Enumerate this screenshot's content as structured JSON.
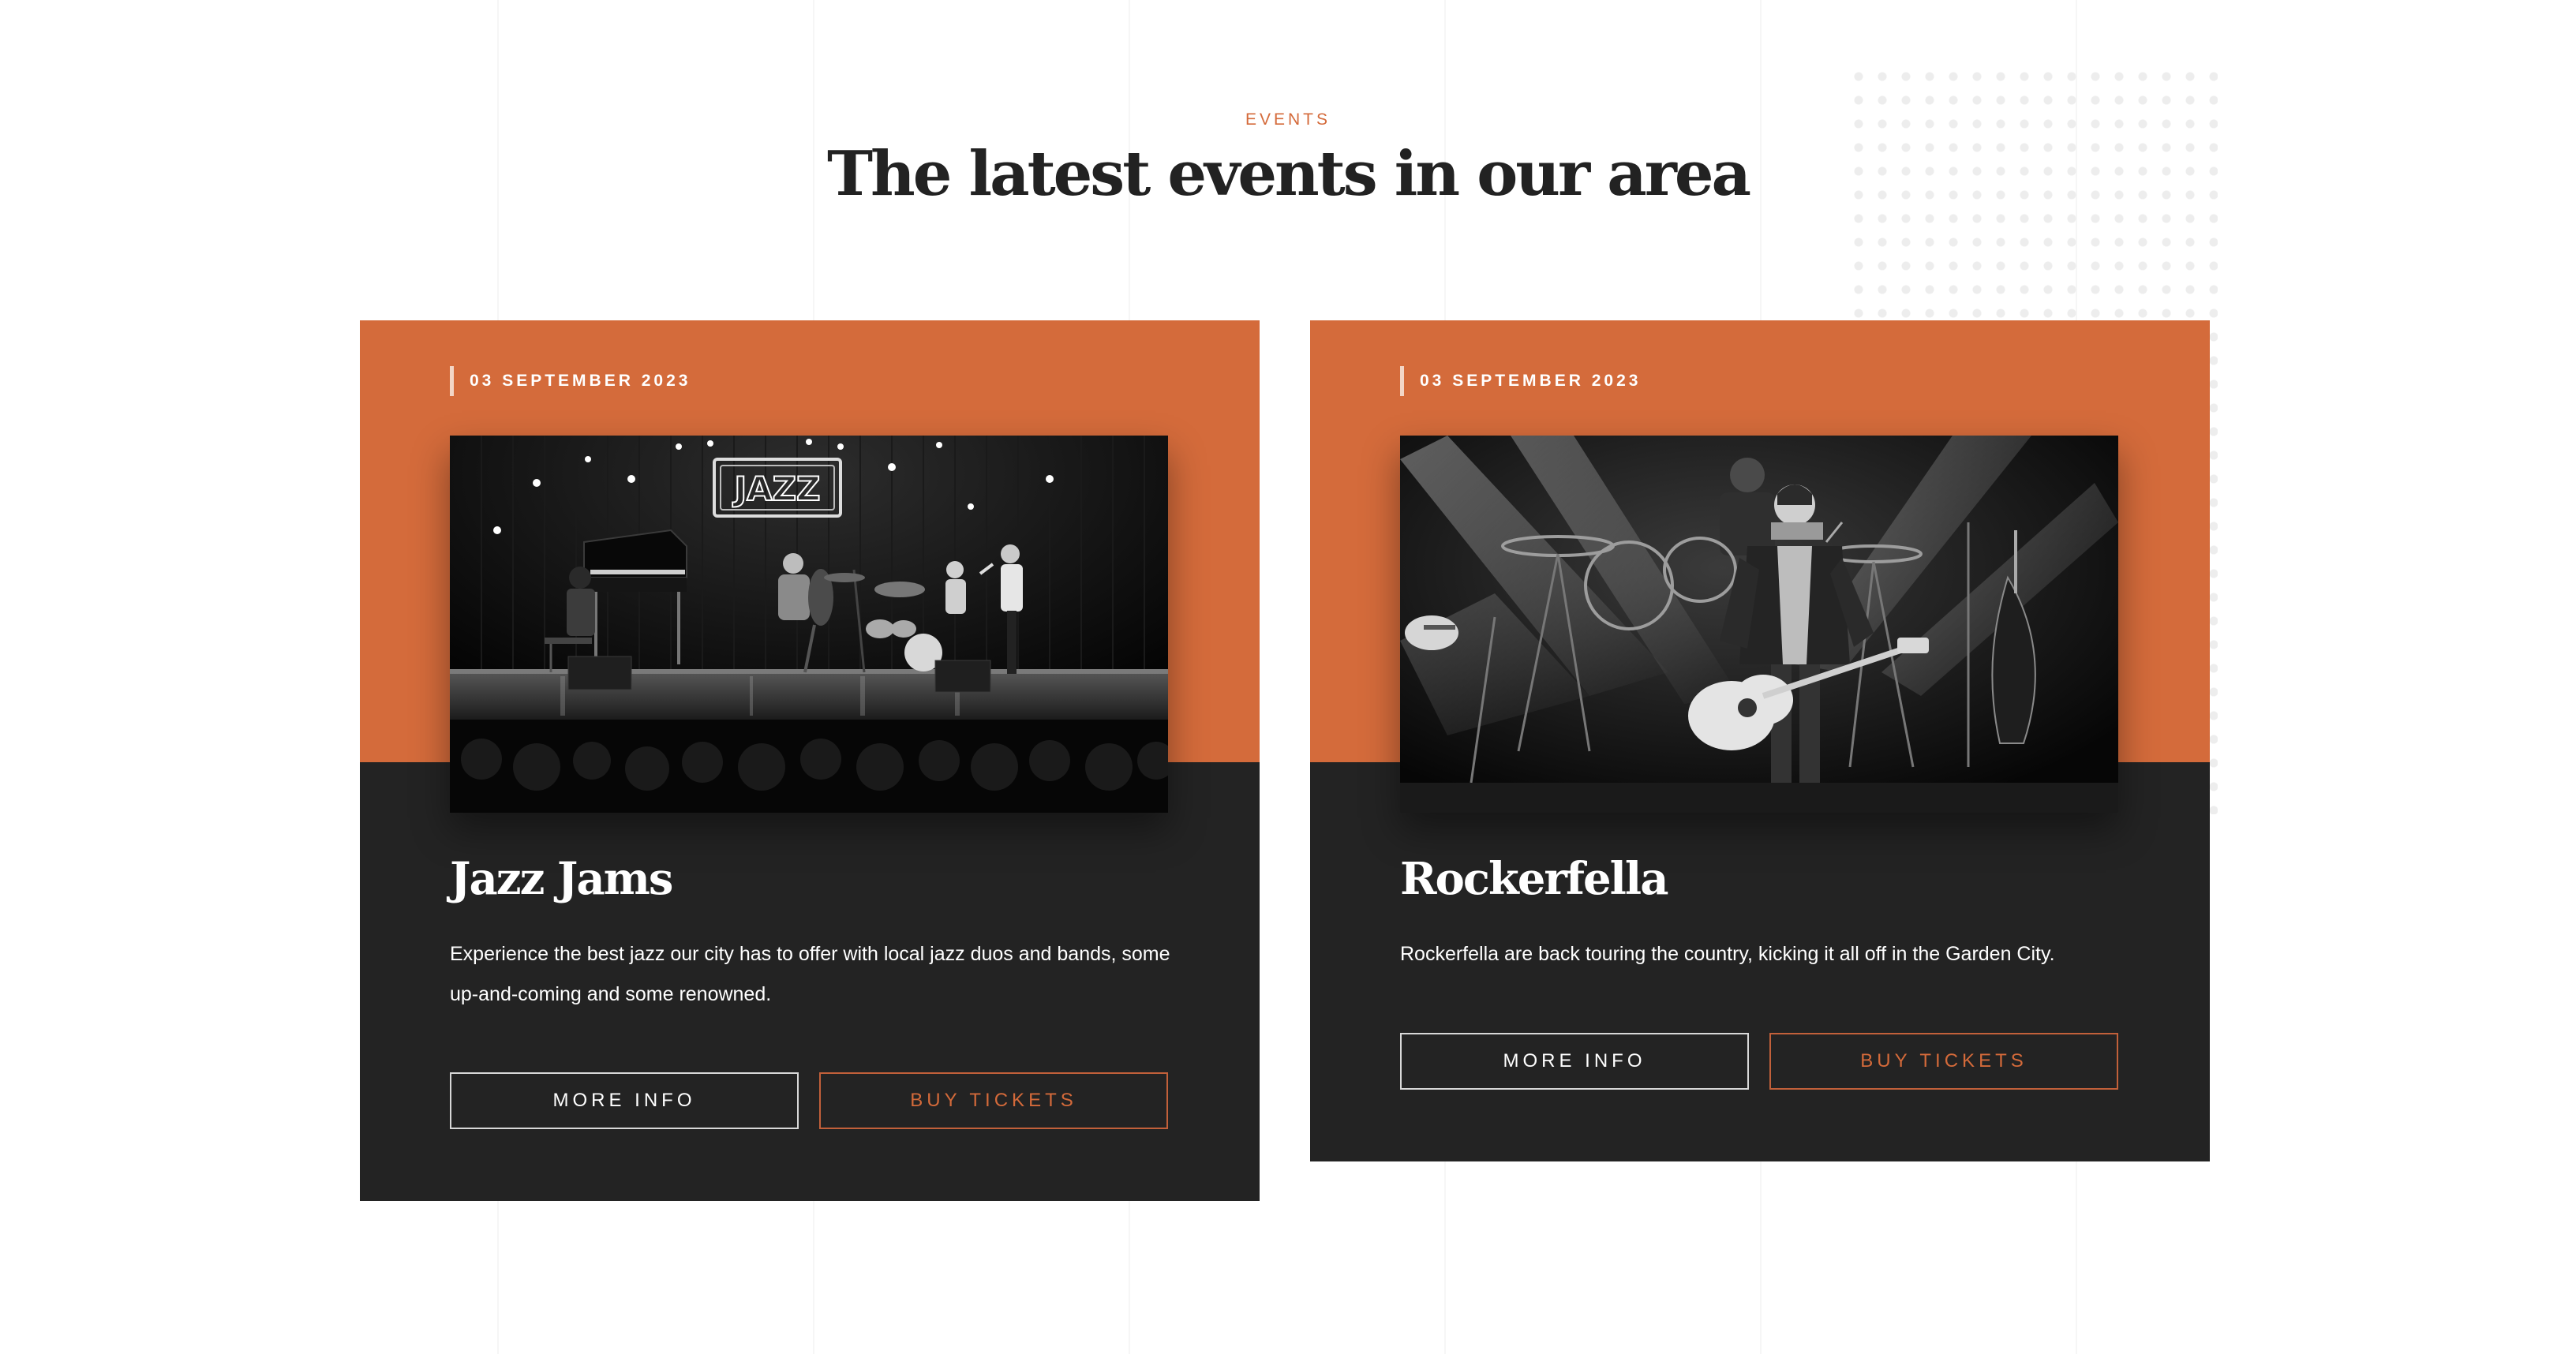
{
  "section": {
    "eyebrow": "EVENTS",
    "title": "The latest events in our area"
  },
  "colors": {
    "accent": "#d46b3b",
    "card_dark": "#232323",
    "heading": "#222222"
  },
  "events": [
    {
      "date": "03 SEPTEMBER 2023",
      "image_sign": "JAZZ",
      "title": "Jazz Jams",
      "description": "Experience the best jazz our city has to offer with local jazz duos and bands, some up-and-coming and some renowned.",
      "more_info_label": "MORE INFO",
      "buy_tickets_label": "BUY TICKETS"
    },
    {
      "date": "03 SEPTEMBER 2023",
      "title": "Rockerfella",
      "description": "Rockerfella are back touring the country, kicking it all off in the Garden City.",
      "more_info_label": "MORE INFO",
      "buy_tickets_label": "BUY TICKETS"
    }
  ]
}
